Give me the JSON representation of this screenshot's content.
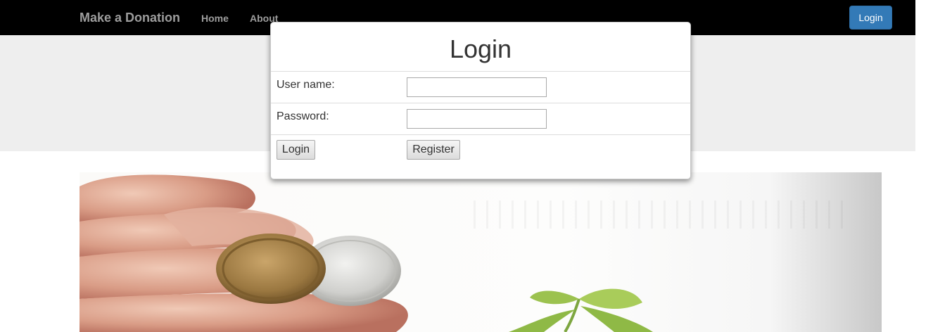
{
  "navbar": {
    "brand": "Make a Donation",
    "links": [
      "Home",
      "About"
    ],
    "login_button": "Login"
  },
  "modal": {
    "title": "Login",
    "username_label": "User name:",
    "username_value": "",
    "password_label": "Password:",
    "password_value": "",
    "login_button": "Login",
    "register_button": "Register"
  },
  "hero": {
    "image_description_icon": "hand-with-coins-and-sprout-image"
  },
  "colors": {
    "navbar_bg": "#000000",
    "primary_button": "#337ab7",
    "jumbotron_bg": "#eeeeee"
  }
}
